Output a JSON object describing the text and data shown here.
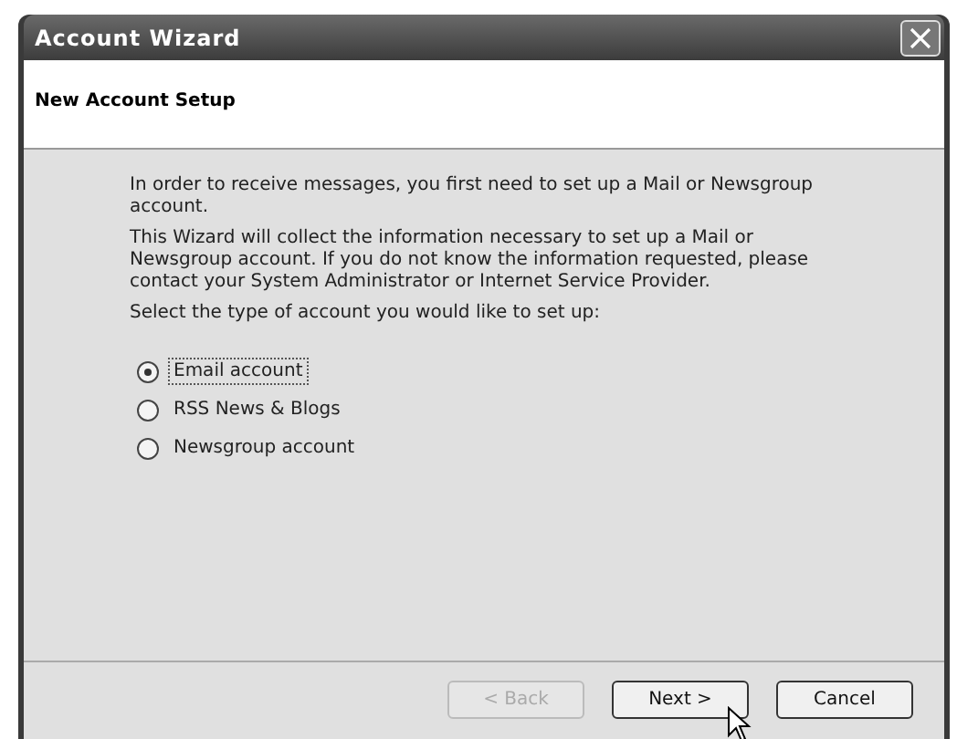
{
  "window": {
    "title": "Account Wizard"
  },
  "header": {
    "title": "New Account Setup"
  },
  "paragraphs": [
    "In order to receive messages, you first need to set up a Mail or Newsgroup account.",
    "This Wizard will collect the information necessary to set up a Mail or Newsgroup account. If you do not know the information requested, please contact your System Administrator or Internet Service Provider.",
    "Select the type of account you would like to set up:"
  ],
  "options": [
    {
      "label": "Email account",
      "selected": true,
      "focused": true
    },
    {
      "label": "RSS News & Blogs",
      "selected": false,
      "focused": false
    },
    {
      "label": "Newsgroup account",
      "selected": false,
      "focused": false
    }
  ],
  "buttons": [
    {
      "label": "< Back",
      "disabled": true
    },
    {
      "label": "Next >",
      "disabled": false
    },
    {
      "label": "Cancel",
      "disabled": false
    }
  ]
}
